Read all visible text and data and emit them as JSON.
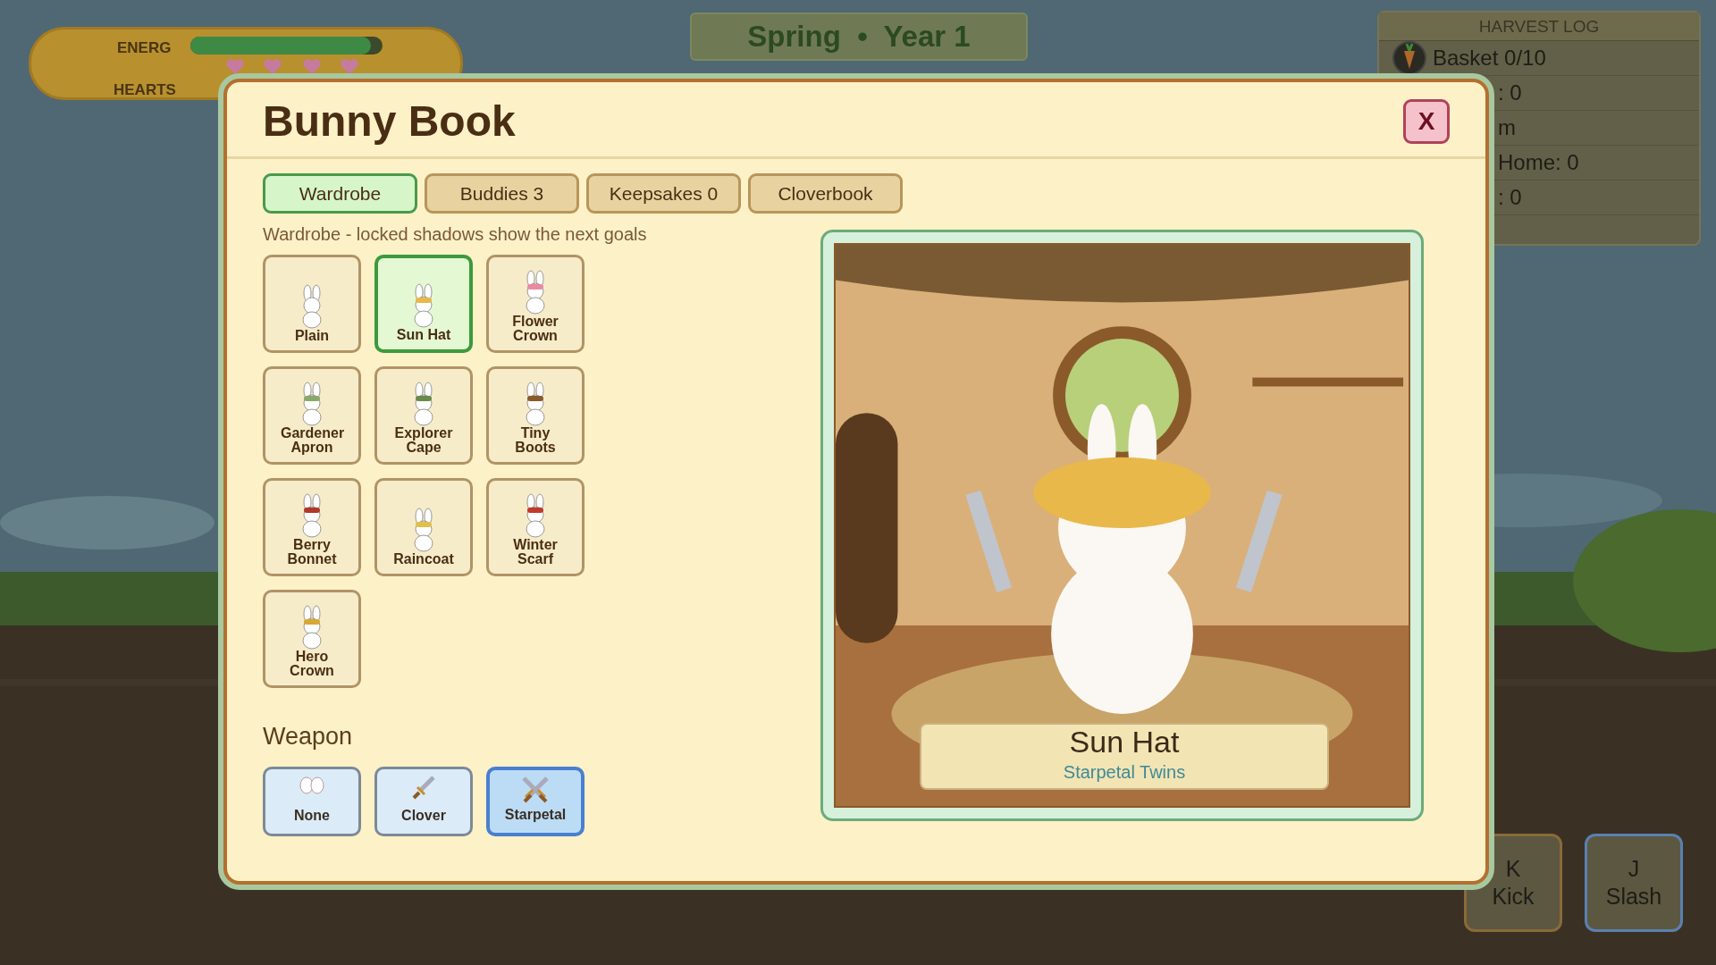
{
  "hud": {
    "energy_label": "ENERG",
    "energy": {
      "level": 0.94
    },
    "hearts_label": "HEARTS"
  },
  "season_banner": "Spring  •  Year 1",
  "harvest_log": {
    "title": "HARVEST LOG",
    "rows": [
      "Basket 0/10",
      ": 0",
      "m",
      "Home: 0",
      ": 0"
    ]
  },
  "modal": {
    "title": "Bunny Book",
    "close": "X",
    "tabs": [
      {
        "label": "Wardrobe",
        "selected": true
      },
      {
        "label": "Buddies 3",
        "selected": false
      },
      {
        "label": "Keepsakes 0",
        "selected": false
      },
      {
        "label": "Cloverbook",
        "selected": false
      }
    ],
    "subtitle": "Wardrobe - locked shadows show the next goals",
    "outfits": [
      {
        "label": "Plain",
        "selected": false
      },
      {
        "label": "Sun Hat",
        "selected": true
      },
      {
        "label": "Flower Crown",
        "selected": false
      },
      {
        "label": "Gardener Apron",
        "selected": false
      },
      {
        "label": "Explorer Cape",
        "selected": false
      },
      {
        "label": "Tiny Boots",
        "selected": false
      },
      {
        "label": "Berry Bonnet",
        "selected": false
      },
      {
        "label": "Raincoat",
        "selected": false
      },
      {
        "label": "Winter Scarf",
        "selected": false
      },
      {
        "label": "Hero Crown",
        "selected": false
      }
    ],
    "weapon_heading": "Weapon",
    "weapons": [
      {
        "label": "None",
        "selected": false
      },
      {
        "label": "Clover",
        "selected": false
      },
      {
        "label": "Starpetal",
        "selected": true
      }
    ],
    "preview": {
      "kind": "picture",
      "name": "Sun Hat",
      "weapon": "Starpetal Twins"
    }
  },
  "actions": [
    {
      "key": "K",
      "label": "Kick",
      "color": "#8a6a3a"
    },
    {
      "key": "J",
      "label": "Slash",
      "color": "#5a80b0"
    }
  ]
}
